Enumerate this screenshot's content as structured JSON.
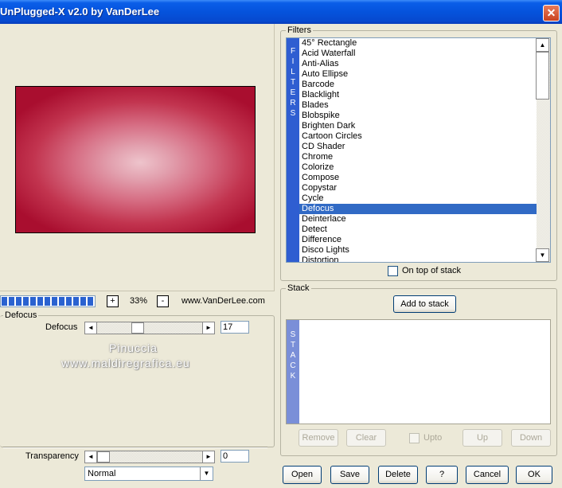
{
  "window": {
    "title": "UnPlugged-X v2.0 by VanDerLee",
    "close_symbol": "✕"
  },
  "filters": {
    "group_label": "Filters",
    "strip_letters": [
      "F",
      "I",
      "L",
      "T",
      "E",
      "R",
      "S"
    ],
    "items": [
      "45° Rectangle",
      "Acid Waterfall",
      "Anti-Alias",
      "Auto Ellipse",
      "Barcode",
      "Blacklight",
      "Blades",
      "Blobspike",
      "Brighten Dark",
      "Cartoon Circles",
      "CD Shader",
      "Chrome",
      "Colorize",
      "Compose",
      "Copystar",
      "Cycle",
      "Defocus",
      "Deinterlace",
      "Detect",
      "Difference",
      "Disco Lights",
      "Distortion"
    ],
    "selected_index": 16,
    "scroll_up": "▲",
    "scroll_down": "▼",
    "on_top_label": "On top of stack"
  },
  "stack": {
    "group_label": "Stack",
    "add_button": "Add to stack",
    "strip_letters": [
      "S",
      "T",
      "A",
      "C",
      "K"
    ],
    "remove_button": "Remove",
    "clear_button": "Clear",
    "upto_label": "Upto",
    "up_button": "Up",
    "down_button": "Down"
  },
  "zoom": {
    "plus": "+",
    "minus": "-",
    "value": "33%",
    "website": "www.VanDerLee.com",
    "progress_fraction": 1.0
  },
  "defocus": {
    "group_label": "Defocus",
    "param_label": "Defocus",
    "param_value": "17",
    "slider_fraction": 0.38,
    "left_arrow": "◄",
    "right_arrow": "►",
    "watermark_line1": "Pinuccia",
    "watermark_line2": "www.maldiregrafica.eu"
  },
  "transparency": {
    "label": "Transparency",
    "value": "0",
    "slider_fraction": 0.0,
    "blend_mode": "Normal",
    "dropdown_arrow": "▼"
  },
  "buttons": {
    "open": "Open",
    "save": "Save",
    "delete": "Delete",
    "help": "?",
    "cancel": "Cancel",
    "ok": "OK"
  },
  "colors": {
    "titlebar": "#0553dc",
    "filters_strip": "#2f5ed1",
    "selection": "#316ac5",
    "stack_strip": "#7a8fd8",
    "preview_edge": "#a90e2f",
    "preview_center": "#eec4cc"
  }
}
